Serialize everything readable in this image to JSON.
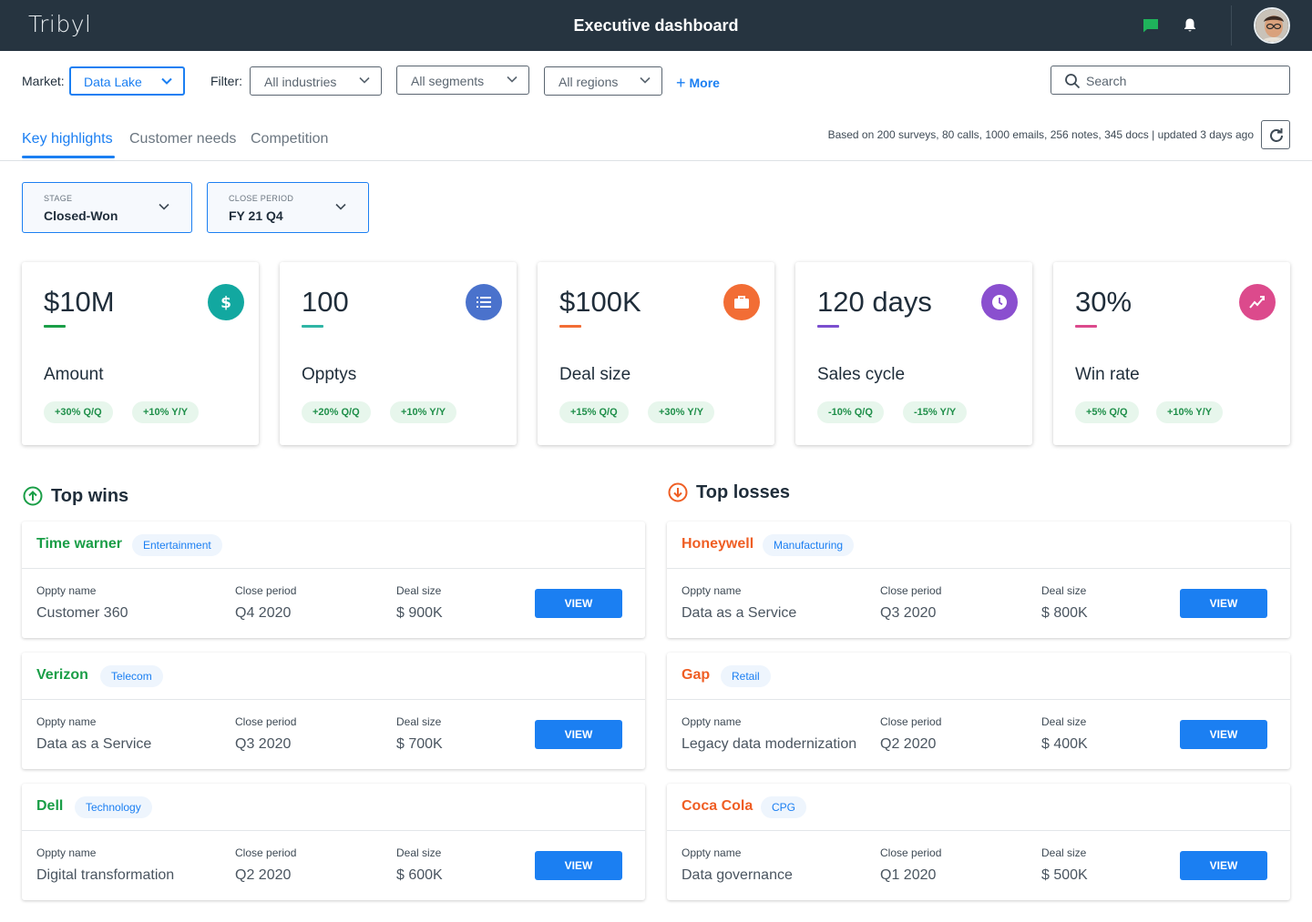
{
  "header": {
    "logo": "Tribyl",
    "title": "Executive dashboard"
  },
  "filters": {
    "market_label": "Market:",
    "market_value": "Data Lake",
    "filter_label": "Filter:",
    "industries": "All industries",
    "segments": "All segments",
    "regions": "All regions",
    "more": "More",
    "search_placeholder": "Search"
  },
  "tabs": [
    {
      "label": "Key highlights"
    },
    {
      "label": "Customer needs"
    },
    {
      "label": "Competition"
    }
  ],
  "basis": "Based on 200 surveys, 80 calls, 1000 emails, 256 notes, 345 docs | updated 3 days ago",
  "selectors": {
    "stage_label": "STAGE",
    "stage_value": "Closed-Won",
    "period_label": "CLOSE PERIOD",
    "period_value": "FY 21 Q4"
  },
  "kpis": [
    {
      "value": "$10M",
      "label": "Amount",
      "qq": "+30% Q/Q",
      "yy": "+10% Y/Y",
      "color": "#12a8a0",
      "accent": "#1a9e47",
      "icon": "dollar-icon"
    },
    {
      "value": "100",
      "label": "Opptys",
      "qq": "+20% Q/Q",
      "yy": "+10% Y/Y",
      "color": "#4a72cc",
      "accent": "#2fb5a5",
      "icon": "list-icon"
    },
    {
      "value": "$100K",
      "label": "Deal size",
      "qq": "+15% Q/Q",
      "yy": "+30% Y/Y",
      "color": "#f26d35",
      "accent": "#f26d35",
      "icon": "briefcase-icon"
    },
    {
      "value": "120 days",
      "label": "Sales cycle",
      "qq": "-10% Q/Q",
      "yy": "-15% Y/Y",
      "color": "#8a4fcf",
      "accent": "#7b4fcf",
      "icon": "clock-icon"
    },
    {
      "value": "30%",
      "label": "Win rate",
      "qq": "+5% Q/Q",
      "yy": "+10% Y/Y",
      "color": "#dc4a8c",
      "accent": "#dc4a8c",
      "icon": "trend-icon"
    }
  ],
  "wins": {
    "title": "Top wins",
    "items": [
      {
        "company": "Time warner",
        "industry": "Entertainment",
        "oppty": "Customer 360",
        "period": "Q4 2020",
        "deal": "$ 900K"
      },
      {
        "company": "Verizon",
        "industry": "Telecom",
        "oppty": "Data as a Service",
        "period": "Q3 2020",
        "deal": "$ 700K"
      },
      {
        "company": "Dell",
        "industry": "Technology",
        "oppty": "Digital transformation",
        "period": "Q2 2020",
        "deal": "$ 600K"
      }
    ]
  },
  "losses": {
    "title": "Top losses",
    "items": [
      {
        "company": "Honeywell",
        "industry": "Manufacturing",
        "oppty": "Data as a Service",
        "period": "Q3 2020",
        "deal": "$ 800K"
      },
      {
        "company": "Gap",
        "industry": "Retail",
        "oppty": "Legacy data modernization",
        "period": "Q2 2020",
        "deal": "$ 400K"
      },
      {
        "company": "Coca Cola",
        "industry": "CPG",
        "oppty": "Data governance",
        "period": "Q1 2020",
        "deal": "$ 500K"
      }
    ]
  },
  "labels": {
    "oppty": "Oppty name",
    "period": "Close period",
    "deal": "Deal size",
    "view": "VIEW"
  },
  "colors": {
    "primary": "#1b7ff2",
    "topbar": "#263440",
    "win": "#1a9e47",
    "loss": "#ef5e24",
    "chat": "#1fb35b"
  }
}
